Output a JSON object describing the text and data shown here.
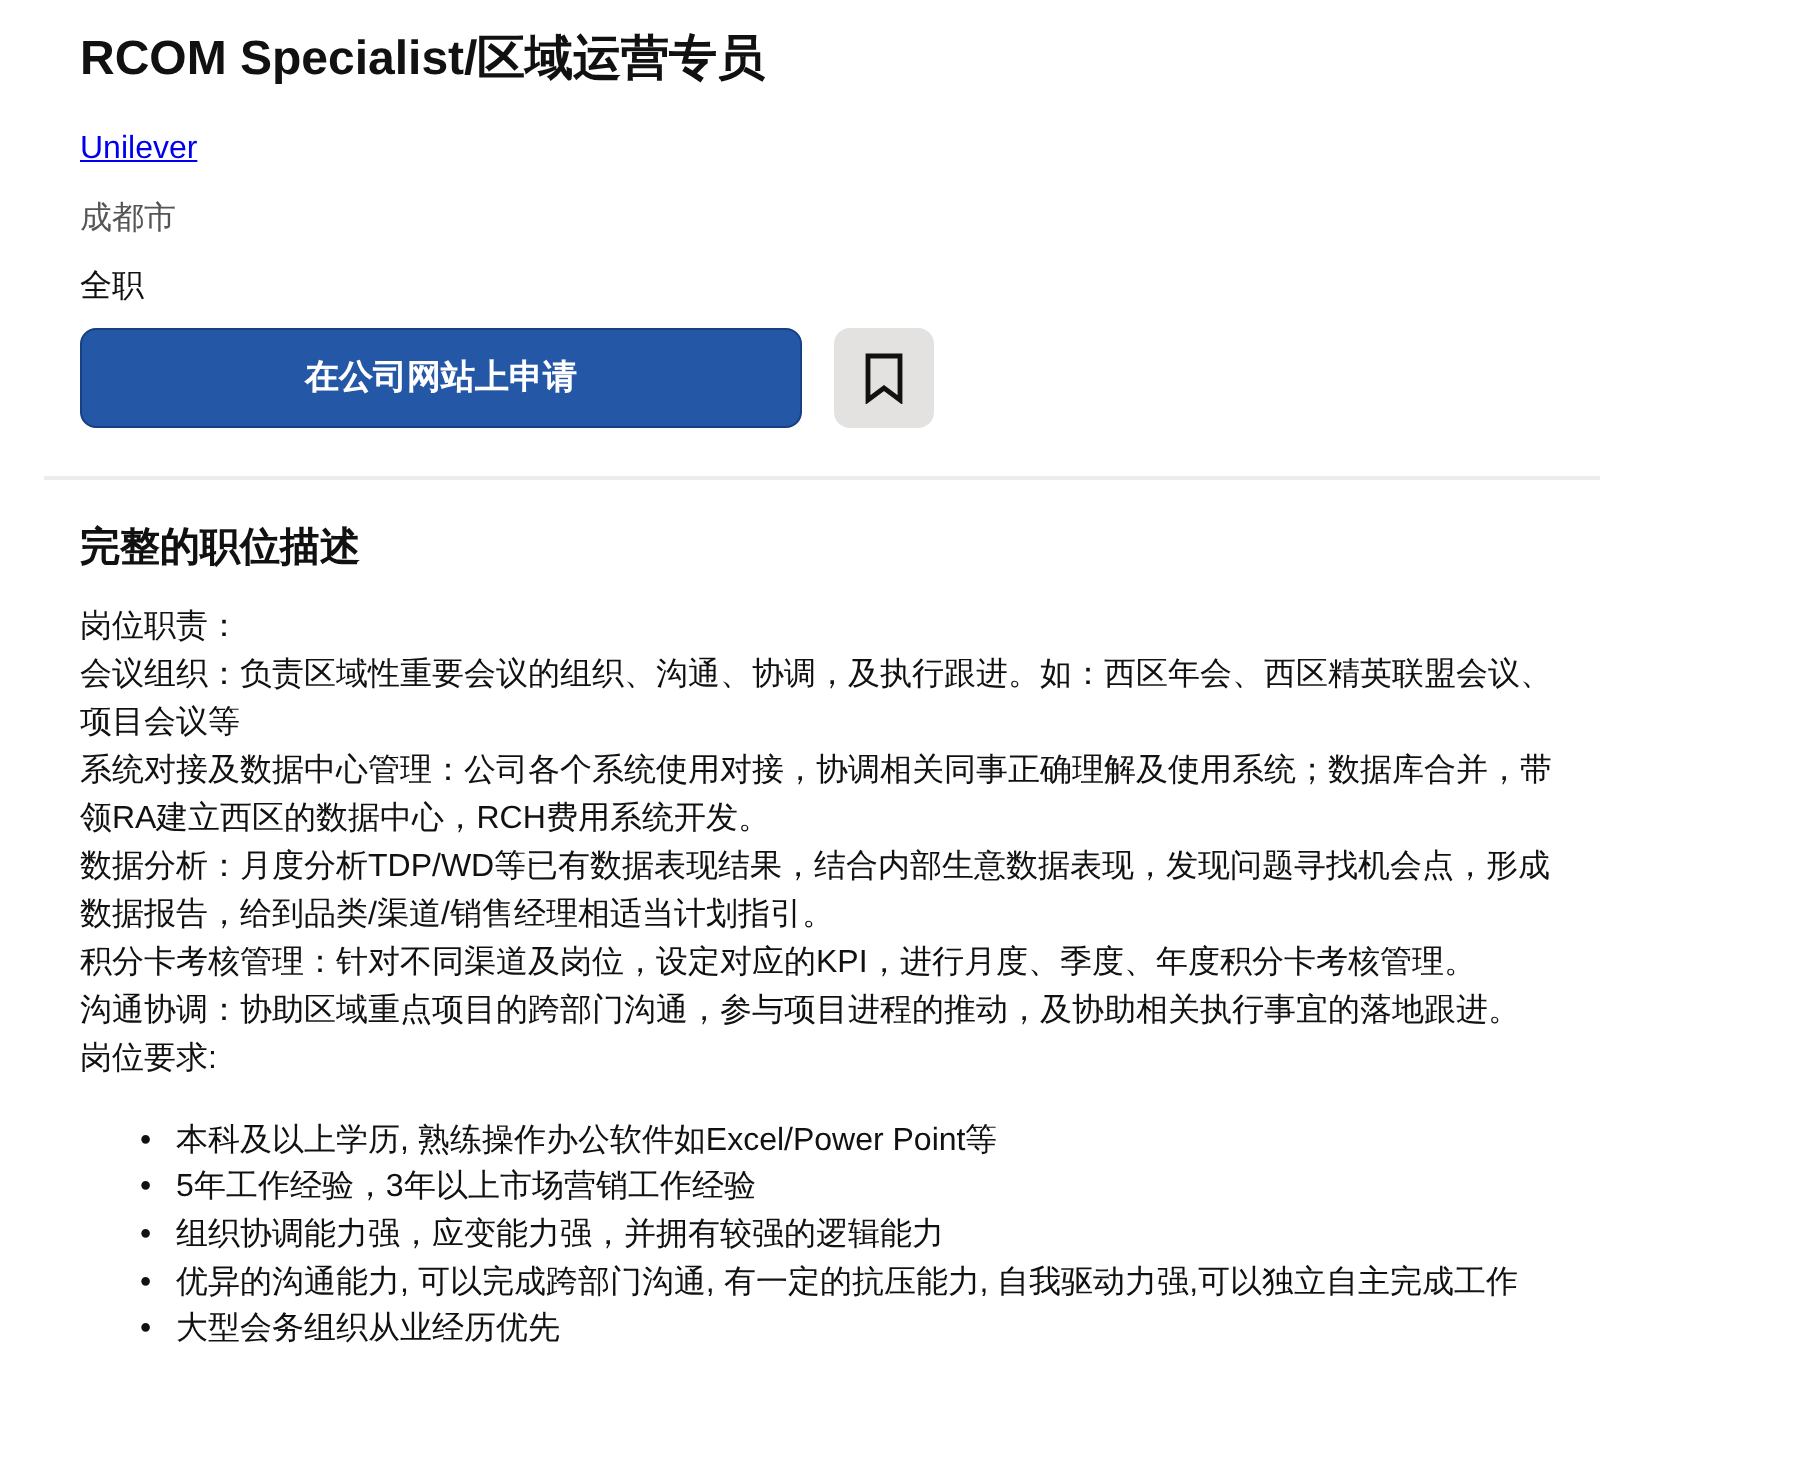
{
  "job": {
    "title": "RCOM Specialist/区域运营专员",
    "company": "Unilever",
    "location": "成都市",
    "job_type": "全职",
    "apply_button": "在公司网站上申请",
    "saved": false
  },
  "description": {
    "heading": "完整的职位描述",
    "paragraphs": [
      "岗位职责：",
      "会议组织：负责区域性重要会议的组织、沟通、协调，及执行跟进。如：西区年会、西区精英联盟会议、项目会议等",
      "系统对接及数据中心管理：公司各个系统使用对接，协调相关同事正确理解及使用系统；数据库合并，带领RA建立西区的数据中心，RCH费用系统开发。",
      "数据分析：月度分析TDP/WD等已有数据表现结果，结合内部生意数据表现，发现问题寻找机会点，形成数据报告，给到品类/渠道/销售经理相适当计划指引。",
      "积分卡考核管理：针对不同渠道及岗位，设定对应的KPI，进行月度、季度、年度积分卡考核管理。",
      "沟通协调：协助区域重点项目的跨部门沟通，参与项目进程的推动，及协助相关执行事宜的落地跟进。",
      "岗位要求:"
    ],
    "requirements": [
      {
        "marker": "•",
        "text": "本科及以上学历, 熟练操作办公软件如Excel/Power Point等"
      },
      {
        "marker": "•",
        "text": "5年工作经验，3年以上市场营销工作经验"
      },
      {
        "marker": "•",
        "text": "组织协调能力强，应变能力强，并拥有较强的逻辑能力"
      },
      {
        "marker": "•",
        "text": "优异的沟通能力, 可以完成跨部门沟通, 有一定的抗压能力, 自我驱动力强,可以独立自主完成工作"
      },
      {
        "marker": "•",
        "text": "大型会务组织从业经历优先"
      }
    ]
  }
}
